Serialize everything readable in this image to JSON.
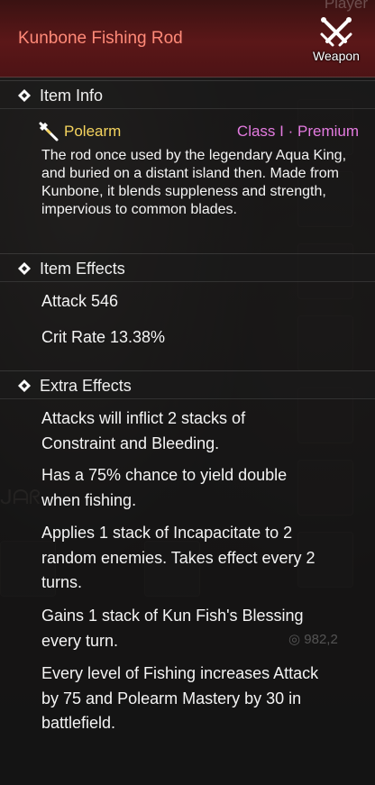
{
  "item": {
    "name": "Kunbone Fishing Rod",
    "type_label": "Weapon",
    "type_icon": "crossed-swords-icon"
  },
  "background": {
    "player_tab": "Player",
    "currency_value": "982,2"
  },
  "info": {
    "heading": "Item Info",
    "category": "Polearm",
    "category_icon": "polearm-icon",
    "class_text": "Class I · Premium",
    "description": "The rod once used by the legendary Aqua King, and buried on a distant island then. Made from Kunbone, it blends suppleness and strength, impervious to common blades."
  },
  "effects": {
    "heading": "Item Effects",
    "attack": "Attack  546",
    "crit": "Crit Rate  13.38%"
  },
  "extra": {
    "heading": "Extra Effects",
    "lines": [
      "Attacks will inflict 2 stacks of",
      "Constraint and Bleeding.",
      "Has a 75% chance to yield double",
      "when fishing.",
      "Applies 1 stack of Incapacitate to 2",
      "random enemies. Takes effect every 2",
      "turns.",
      "Gains 1 stack of Kun Fish's Blessing",
      "every turn.",
      "Every level of Fishing increases Attack",
      "by 75 and Polearm Mastery by 30 in",
      "battlefield."
    ]
  },
  "colors": {
    "title": "#ff8a78",
    "category": "#f4d35e",
    "class": "#e47be0",
    "header_bg": "#5b1718"
  }
}
